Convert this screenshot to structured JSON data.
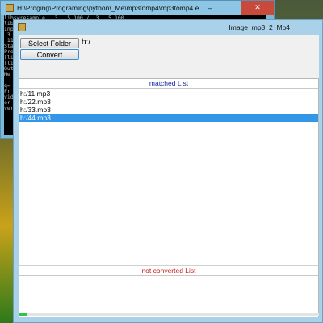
{
  "console": {
    "title": "H:\\Proging\\Programing\\python\\_Me\\mp3tomp4\\mp3tomp4.exe",
    "min_symbol": "–",
    "max_symbol": "□",
    "close_symbol": "✕",
    "lines": [
      "libswresample   3.  5.100 /  3.  5.100",
      "libpostproc    55.  5.100 / 55.  5.100",
      "",
      "Inp",
      " 3",
      " 11",
      "",
      "Sta",
      "Pre",
      "[li",
      "[lib",
      "Out",
      "Me",
      "",
      "  ",
      "q=-",
      "",
      "",
      "Fr",
      "vid",
      "er",
      "ver"
    ]
  },
  "app": {
    "title": "Image_mp3_2_Mp4",
    "select_folder_label": "Select Folder",
    "convert_label": "Convert",
    "path": "h:/",
    "matched_header": "matched List",
    "matched_items": [
      "h:/11.mp3",
      "h:/22.mp3",
      "h:/33.mp3",
      "h:/44.mp3"
    ],
    "selected_index": 3,
    "not_converted_header": "not converted List",
    "progress_fraction": 0.03,
    "scroll_left": "<",
    "scroll_right": ">"
  },
  "colors": {
    "matched_header": "#1a2aa0",
    "not_converted_header": "#c81818",
    "selection": "#3396e8",
    "progress": "#2ec44a"
  }
}
